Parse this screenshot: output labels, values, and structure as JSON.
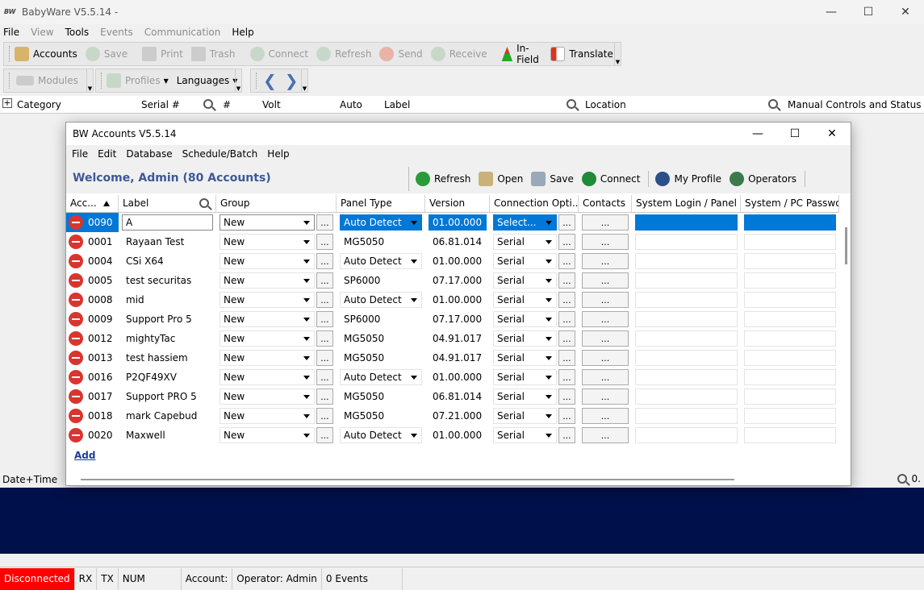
{
  "app": {
    "title": "BabyWare V5.5.14 -",
    "icon_text": "BW"
  },
  "menu": [
    "File",
    "View",
    "Tools",
    "Events",
    "Communication",
    "Help"
  ],
  "toolbar1": {
    "accounts": "Accounts",
    "save": "Save",
    "print": "Print",
    "trash": "Trash",
    "connect": "Connect",
    "refresh": "Refresh",
    "send": "Send",
    "receive": "Receive",
    "infield": "In-Field",
    "translate": "Translate"
  },
  "toolbar2": {
    "modules": "Modules",
    "profiles": "Profiles",
    "languages": "Languages"
  },
  "catbar": {
    "category": "Category",
    "serial": "Serial #",
    "hash": "#",
    "volt": "Volt",
    "auto": "Auto",
    "label": "Label",
    "location": "Location",
    "manual": "Manual Controls and Status"
  },
  "lower": {
    "datetime": "Date+Time",
    "zoom": "0."
  },
  "status": {
    "disconnected": "Disconnected",
    "rx": "RX",
    "tx": "TX",
    "num": "NUM",
    "account": "Account:",
    "operator": "Operator: Admin",
    "events": "0 Events"
  },
  "dialog": {
    "title": "Accounts V5.5.14",
    "menu": [
      "File",
      "Edit",
      "Database",
      "Schedule/Batch",
      "Help"
    ],
    "welcome": "Welcome, Admin  (80 Accounts)",
    "tools": {
      "refresh": "Refresh",
      "open": "Open",
      "save": "Save",
      "connect": "Connect",
      "profile": "My Profile",
      "operators": "Operators"
    },
    "columns": {
      "acc": "Acc...",
      "label": "Label",
      "group": "Group",
      "panel": "Panel Type",
      "version": "Version",
      "conn": "Connection Opti...",
      "contacts": "Contacts",
      "syslogin": "System Login / Panel ...",
      "syspwd": "System / PC Password"
    },
    "dots": "...",
    "add": "Add",
    "rows": [
      {
        "acc": "0090",
        "label": "A",
        "group": "New",
        "panel": "Auto Detect",
        "version": "01.00.000",
        "conn": "Select..."
      },
      {
        "acc": "0001",
        "label": "Rayaan Test",
        "group": "New",
        "panel": "MG5050",
        "version": "06.81.014",
        "conn": "Serial"
      },
      {
        "acc": "0004",
        "label": "CSi X64",
        "group": "New",
        "panel": "Auto Detect",
        "version": "01.00.000",
        "conn": "Serial"
      },
      {
        "acc": "0005",
        "label": "test securitas",
        "group": "New",
        "panel": "SP6000",
        "version": "07.17.000",
        "conn": "Serial"
      },
      {
        "acc": "0008",
        "label": "mid",
        "group": "New",
        "panel": "Auto Detect",
        "version": "01.00.000",
        "conn": "Serial"
      },
      {
        "acc": "0009",
        "label": "Support Pro 5",
        "group": "New",
        "panel": "SP6000",
        "version": "07.17.000",
        "conn": "Serial"
      },
      {
        "acc": "0012",
        "label": "mightyTac",
        "group": "New",
        "panel": "MG5050",
        "version": "04.91.017",
        "conn": "Serial"
      },
      {
        "acc": "0013",
        "label": "test hassiem",
        "group": "New",
        "panel": "MG5050",
        "version": "04.91.017",
        "conn": "Serial"
      },
      {
        "acc": "0016",
        "label": "P2QF49XV",
        "group": "New",
        "panel": "Auto Detect",
        "version": "01.00.000",
        "conn": "Serial"
      },
      {
        "acc": "0017",
        "label": "Support PRO 5",
        "group": "New",
        "panel": "MG5050",
        "version": "06.81.014",
        "conn": "Serial"
      },
      {
        "acc": "0018",
        "label": "mark Capebud",
        "group": "New",
        "panel": "MG5050",
        "version": "07.21.000",
        "conn": "Serial"
      },
      {
        "acc": "0020",
        "label": "Maxwell",
        "group": "New",
        "panel": "Auto Detect",
        "version": "01.00.000",
        "conn": "Serial"
      }
    ]
  },
  "colors": {
    "selection": "#0078d7",
    "welcome": "#3b5998",
    "disconnected": "#ff0000",
    "dark_pane": "#00104a",
    "delete": "#d9352f"
  }
}
